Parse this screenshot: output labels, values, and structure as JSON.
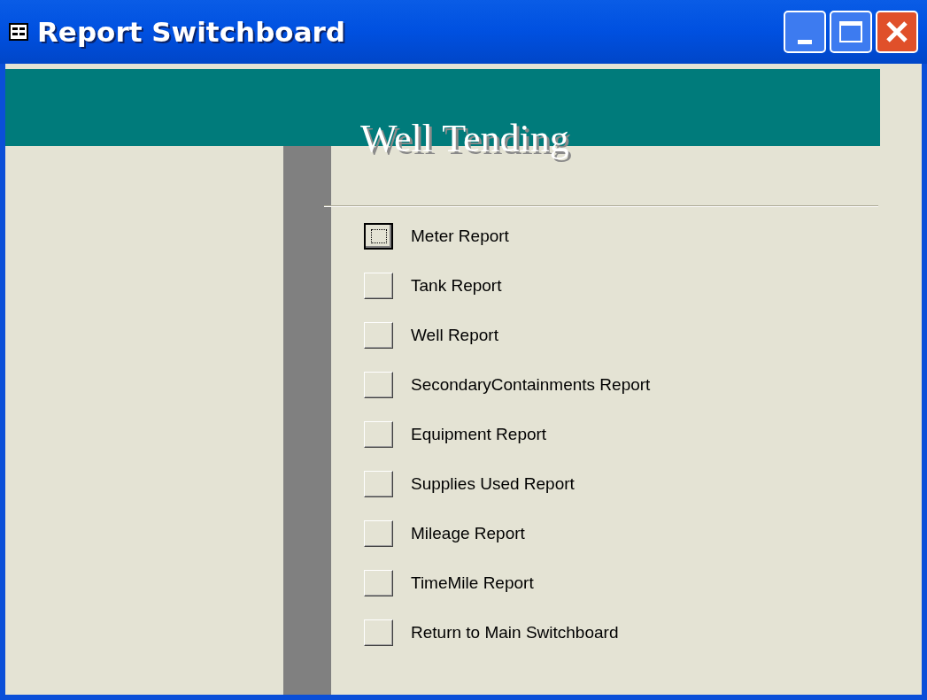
{
  "window": {
    "title": "Report Switchboard"
  },
  "header": {
    "title": "Well Tending"
  },
  "items": [
    {
      "label": "Meter Report",
      "focused": true
    },
    {
      "label": "Tank Report",
      "focused": false
    },
    {
      "label": "Well Report",
      "focused": false
    },
    {
      "label": "SecondaryContainments Report",
      "focused": false
    },
    {
      "label": "Equipment Report",
      "focused": false
    },
    {
      "label": "Supplies Used Report",
      "focused": false
    },
    {
      "label": "Mileage Report",
      "focused": false
    },
    {
      "label": "TimeMile Report",
      "focused": false
    },
    {
      "label": "Return to Main Switchboard",
      "focused": false
    }
  ]
}
